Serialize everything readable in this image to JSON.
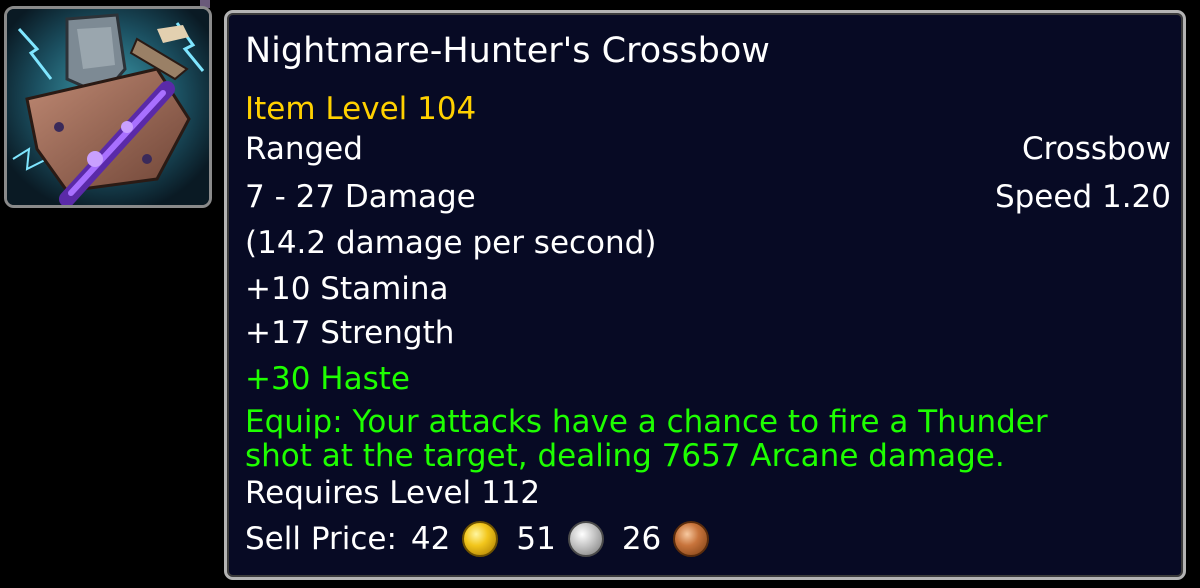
{
  "item": {
    "name": "Nightmare-Hunter's Crossbow",
    "item_level": "Item Level 104",
    "slot": "Ranged",
    "type": "Crossbow",
    "damage": "7 - 27 Damage",
    "speed": "Speed 1.20",
    "dps": "(14.2 damage per second)",
    "stats": [
      "+10 Stamina",
      "+17 Strength"
    ],
    "green_stat": "+30 Haste",
    "equip_lines": [
      "Equip: Your attacks have a chance to fire a Thunder",
      "shot at the target, dealing 7657 Arcane damage."
    ],
    "requires": "Requires Level 112",
    "sell_label": "Sell Price:",
    "gold": "42",
    "silver": "51",
    "copper": "26"
  },
  "icon": {
    "name": "crossbow-icon"
  },
  "colors": {
    "background": "#000000",
    "tooltip_bg": "#070a24",
    "border": "#b4b4b4",
    "title": "#ffffff",
    "item_level": "#ffd100",
    "green": "#1eff00",
    "text": "#ffffff"
  }
}
